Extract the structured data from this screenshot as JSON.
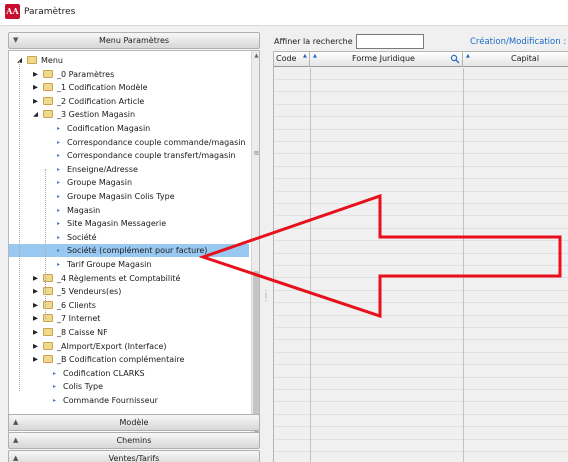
{
  "window": {
    "title": "Paramètres",
    "logo_text": "AA"
  },
  "sidebar": {
    "header": "Menu Paramètres",
    "bottom_headers": [
      "Modèle",
      "Chemins",
      "Ventes/Tarifs"
    ]
  },
  "tree": {
    "items": [
      {
        "label": "Menu",
        "level": 0,
        "kind": "folder",
        "toggle": "open"
      },
      {
        "label": "_0 Paramètres",
        "level": 1,
        "kind": "folder",
        "toggle": "closed"
      },
      {
        "label": "_1 Codification Modèle",
        "level": 1,
        "kind": "folder",
        "toggle": "closed"
      },
      {
        "label": "_2 Codification Article",
        "level": 1,
        "kind": "folder",
        "toggle": "closed"
      },
      {
        "label": "_3 Gestion Magasin",
        "level": 1,
        "kind": "folder",
        "toggle": "open"
      },
      {
        "label": "Codification Magasin",
        "level": 2,
        "kind": "leaf"
      },
      {
        "label": "Correspondance couple commande/magasin",
        "level": 2,
        "kind": "leaf"
      },
      {
        "label": "Correspondance couple transfert/magasin",
        "level": 2,
        "kind": "leaf"
      },
      {
        "label": "Enseigne/Adresse",
        "level": 2,
        "kind": "leaf"
      },
      {
        "label": "Groupe Magasin",
        "level": 2,
        "kind": "leaf"
      },
      {
        "label": "Groupe Magasin Colis Type",
        "level": 2,
        "kind": "leaf"
      },
      {
        "label": "Magasin",
        "level": 2,
        "kind": "leaf"
      },
      {
        "label": "Site Magasin Messagerie",
        "level": 2,
        "kind": "leaf"
      },
      {
        "label": "Société",
        "level": 2,
        "kind": "leaf"
      },
      {
        "label": "Société (complément pour facture)",
        "level": 2,
        "kind": "leaf",
        "selected": true
      },
      {
        "label": "Tarif Groupe Magasin",
        "level": 2,
        "kind": "leaf"
      },
      {
        "label": "_4 Règlements et Comptabilité",
        "level": 1,
        "kind": "folder",
        "toggle": "closed"
      },
      {
        "label": "_5 Vendeurs(es)",
        "level": 1,
        "kind": "folder",
        "toggle": "closed"
      },
      {
        "label": "_6 Clients",
        "level": 1,
        "kind": "folder",
        "toggle": "closed"
      },
      {
        "label": "_7 Internet",
        "level": 1,
        "kind": "folder",
        "toggle": "closed"
      },
      {
        "label": "_8 Caisse NF",
        "level": 1,
        "kind": "folder",
        "toggle": "closed"
      },
      {
        "label": "_AImport/Export (Interface)",
        "level": 1,
        "kind": "folder",
        "toggle": "closed"
      },
      {
        "label": "_B Codification complémentaire",
        "level": 1,
        "kind": "folder",
        "toggle": "closed"
      },
      {
        "label": "Codification CLARKS",
        "level": 1,
        "kind": "leaf"
      },
      {
        "label": "Colis Type",
        "level": 1,
        "kind": "leaf"
      },
      {
        "label": "Commande Fournisseur",
        "level": 1,
        "kind": "leaf"
      }
    ]
  },
  "search": {
    "label": "Affiner la recherche :",
    "value": ""
  },
  "creation_modification": "Création/Modification :",
  "grid": {
    "columns": [
      "Code",
      "Forme Juridique",
      "Capital"
    ],
    "row_count": 32
  },
  "colors": {
    "selection": "#99c9f0",
    "accent_link": "#1d6ac7",
    "arrow": "#e8101c"
  },
  "icons": {
    "expand": "triangle-right-icon",
    "collapse": "triangle-down-icon",
    "folder": "folder-icon",
    "leaf": "leaf-bullet-icon",
    "filter": "magnifier-icon",
    "annotation": "red-arrow-icon"
  }
}
